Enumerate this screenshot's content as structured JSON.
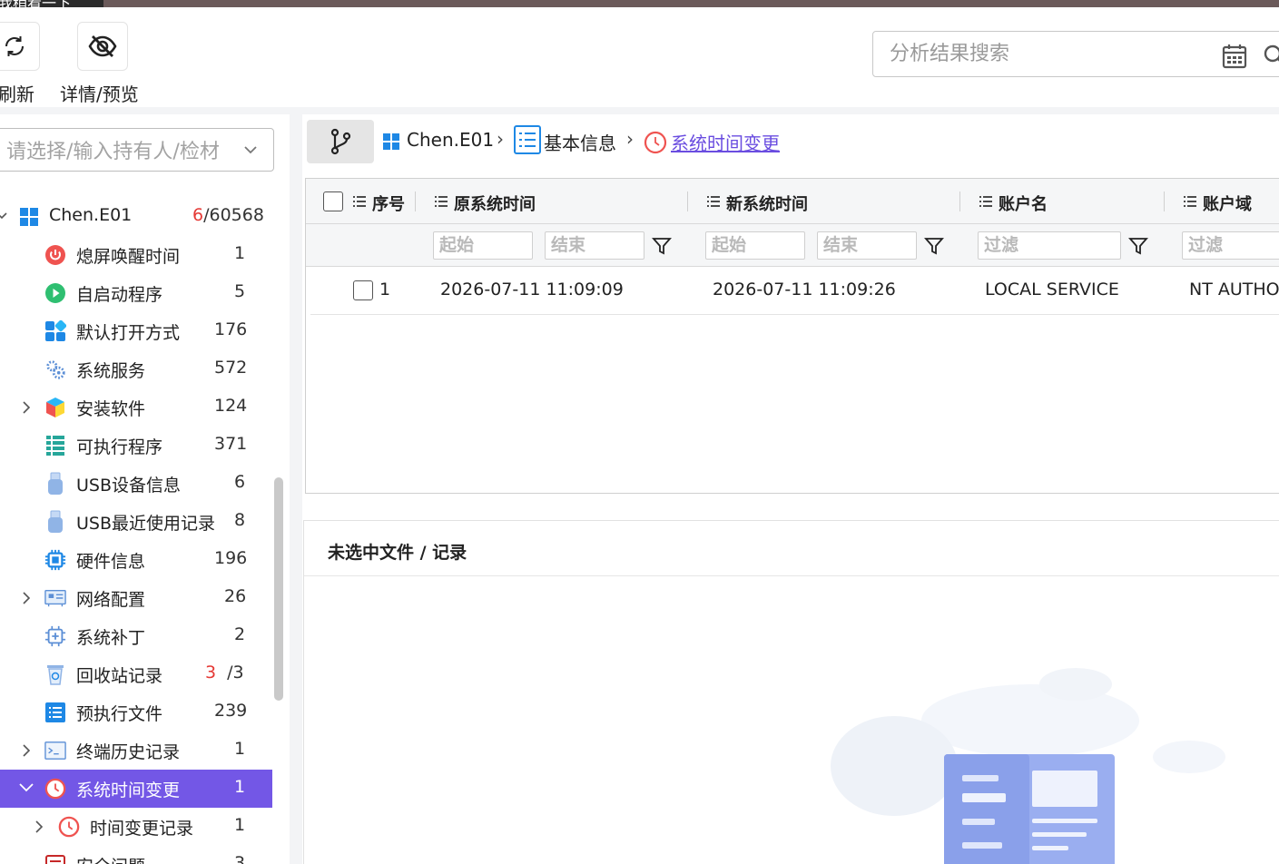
{
  "window": {
    "title_fragment": "我稍看一下"
  },
  "toolbar": {
    "refresh_label": "刷新",
    "detail_label": "详情/预览"
  },
  "search": {
    "placeholder": "分析结果搜索"
  },
  "selector": {
    "placeholder": "请选择/输入持有人/检材"
  },
  "tree": {
    "root": {
      "label": "Chen.E01",
      "count_red": "6",
      "count_rest": "/60568"
    },
    "items": [
      {
        "label": "熄屏唤醒时间",
        "count": "1",
        "icon": "power-icon"
      },
      {
        "label": "自启动程序",
        "count": "5",
        "icon": "play-icon"
      },
      {
        "label": "默认打开方式",
        "count": "176",
        "icon": "apps-icon"
      },
      {
        "label": "系统服务",
        "count": "572",
        "icon": "gears-icon"
      },
      {
        "label": "安装软件",
        "count": "124",
        "icon": "box-icon"
      },
      {
        "label": "可执行程序",
        "count": "371",
        "icon": "list-icon"
      },
      {
        "label": "USB设备信息",
        "count": "6",
        "icon": "usb-icon"
      },
      {
        "label": "USB最近使用记录",
        "count": "8",
        "icon": "usb-icon"
      },
      {
        "label": "硬件信息",
        "count": "196",
        "icon": "chip-icon"
      },
      {
        "label": "网络配置",
        "count": "26",
        "icon": "network-icon"
      },
      {
        "label": "系统补丁",
        "count": "2",
        "icon": "patch-icon"
      },
      {
        "label": "回收站记录",
        "count_red": "3",
        "count_rest": "/3",
        "icon": "recycle-bin-icon"
      },
      {
        "label": "预执行文件",
        "count": "239",
        "icon": "prefetch-icon"
      },
      {
        "label": "终端历史记录",
        "count": "1",
        "icon": "terminal-icon"
      },
      {
        "label": "系统时间变更",
        "count": "1",
        "icon": "clock-icon"
      },
      {
        "label": "时间变更记录",
        "count": "1",
        "icon": "clock-icon"
      },
      {
        "label": "安全问题",
        "count": "3",
        "icon": "doc-icon"
      }
    ]
  },
  "breadcrumb": {
    "items": [
      "Chen.E01",
      "基本信息",
      "系统时间变更"
    ]
  },
  "grid": {
    "columns": [
      "序号",
      "原系统时间",
      "新系统时间",
      "账户名",
      "账户域"
    ],
    "filter_start": "起始",
    "filter_end": "结束",
    "filter_text": "过滤",
    "rows": [
      {
        "index": "1",
        "old_time": "2026-07-11 11:09:09",
        "new_time": "2026-07-11 11:09:26",
        "account": "LOCAL SERVICE",
        "domain": "NT AUTHO"
      }
    ]
  },
  "detail_panel": {
    "title": "未选中文件 / 记录"
  },
  "colors": {
    "accent": "#7357e6",
    "count_red": "#e53935",
    "link": "#6a4de0"
  }
}
